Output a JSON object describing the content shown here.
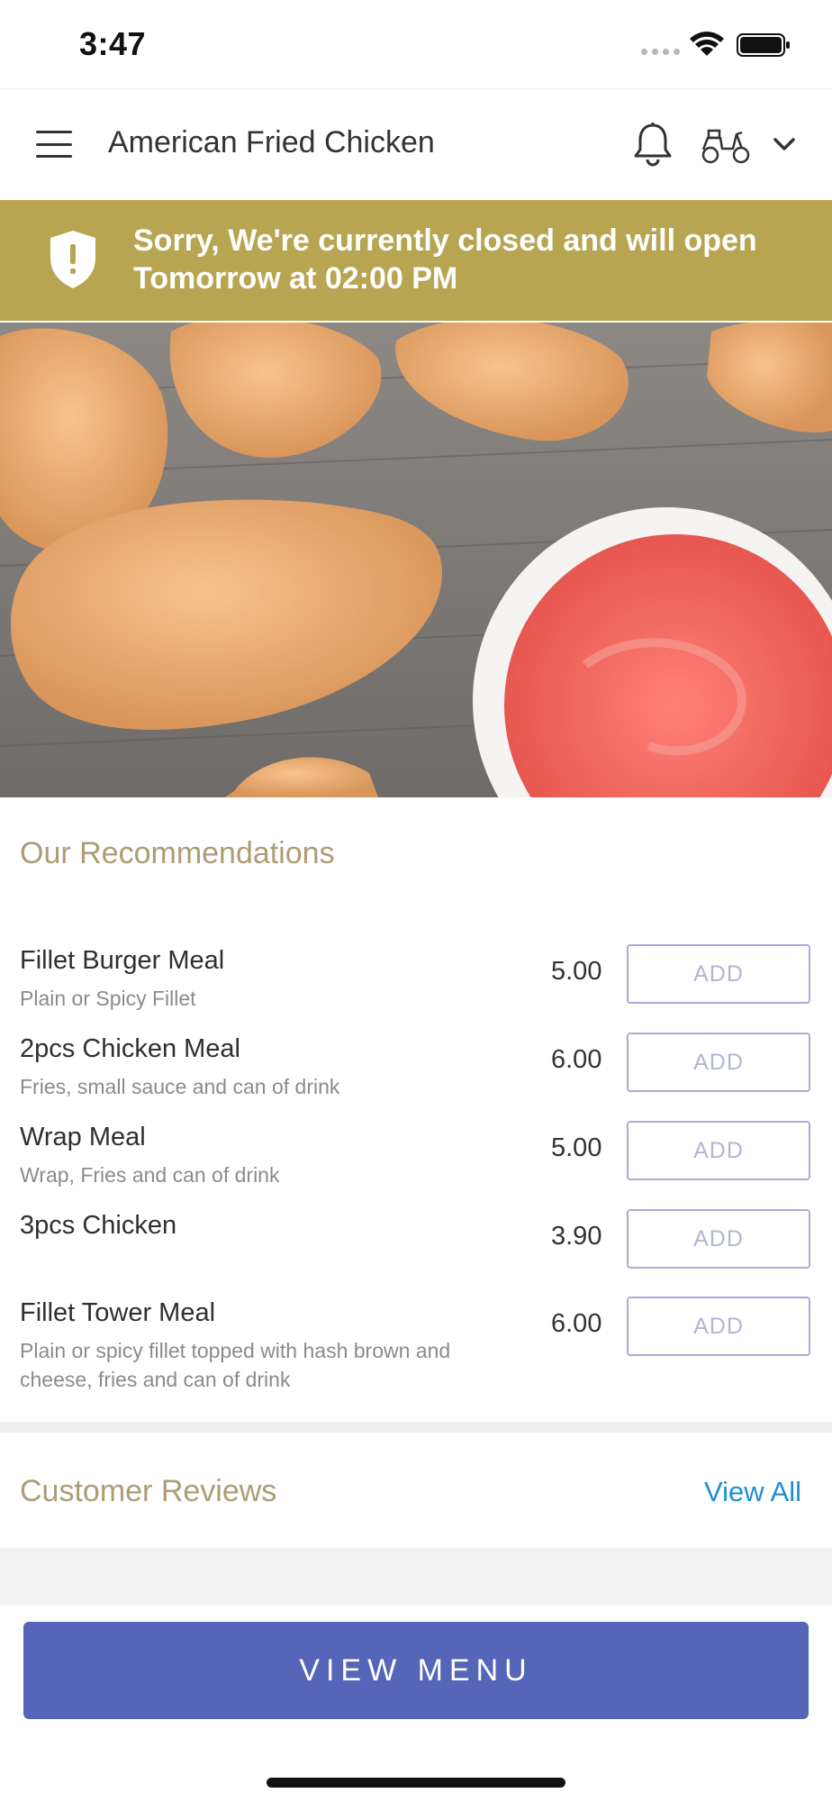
{
  "status_bar": {
    "time": "3:47"
  },
  "header": {
    "title": "American Fried Chicken",
    "icons": [
      "hamburger-menu-icon",
      "bell-icon",
      "scooter-icon",
      "chevron-down-icon"
    ]
  },
  "banner": {
    "message": "Sorry, We're currently closed and will open Tomorrow at 02:00 PM",
    "icon": "shield-exclamation-icon",
    "color": "#b8a552"
  },
  "recommendations": {
    "title": "Our Recommendations",
    "add_label": "ADD",
    "items": [
      {
        "name": "Fillet Burger Meal",
        "desc": "Plain or Spicy Fillet",
        "price": "5.00"
      },
      {
        "name": "2pcs Chicken Meal",
        "desc": "Fries, small sauce and can of drink",
        "price": "6.00"
      },
      {
        "name": "Wrap Meal",
        "desc": "Wrap, Fries and can of drink",
        "price": "5.00"
      },
      {
        "name": "3pcs Chicken",
        "desc": "",
        "price": "3.90"
      },
      {
        "name": "Fillet Tower Meal",
        "desc": "Plain or spicy fillet topped with hash brown and cheese, fries and can of drink",
        "price": "6.00"
      }
    ]
  },
  "reviews": {
    "title": "Customer Reviews",
    "view_all": "View All"
  },
  "footer": {
    "view_menu": "VIEW MENU",
    "accent": "#5565b7"
  }
}
